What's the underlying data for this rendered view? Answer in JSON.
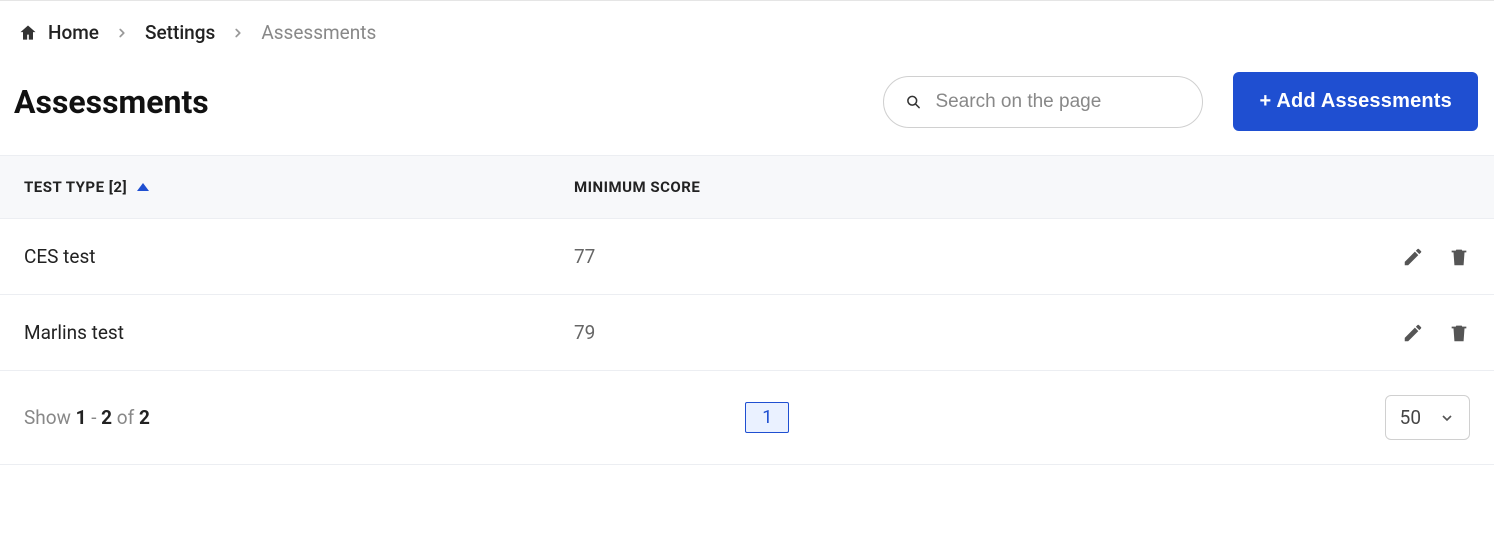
{
  "breadcrumb": {
    "home": "Home",
    "settings": "Settings",
    "current": "Assessments"
  },
  "page": {
    "title": "Assessments"
  },
  "search": {
    "placeholder": "Search on the page"
  },
  "buttons": {
    "add": "+ Add Assessments"
  },
  "table": {
    "headers": {
      "type": "TEST TYPE [2]",
      "score": "MINIMUM SCORE"
    },
    "rows": [
      {
        "type": "CES test",
        "score": "77"
      },
      {
        "type": "Marlins test",
        "score": "79"
      }
    ]
  },
  "pagination": {
    "show_prefix": "Show ",
    "from": "1",
    "dash": " - ",
    "to": "2",
    "of_text": " of ",
    "total": "2",
    "current_page": "1",
    "page_size": "50"
  }
}
